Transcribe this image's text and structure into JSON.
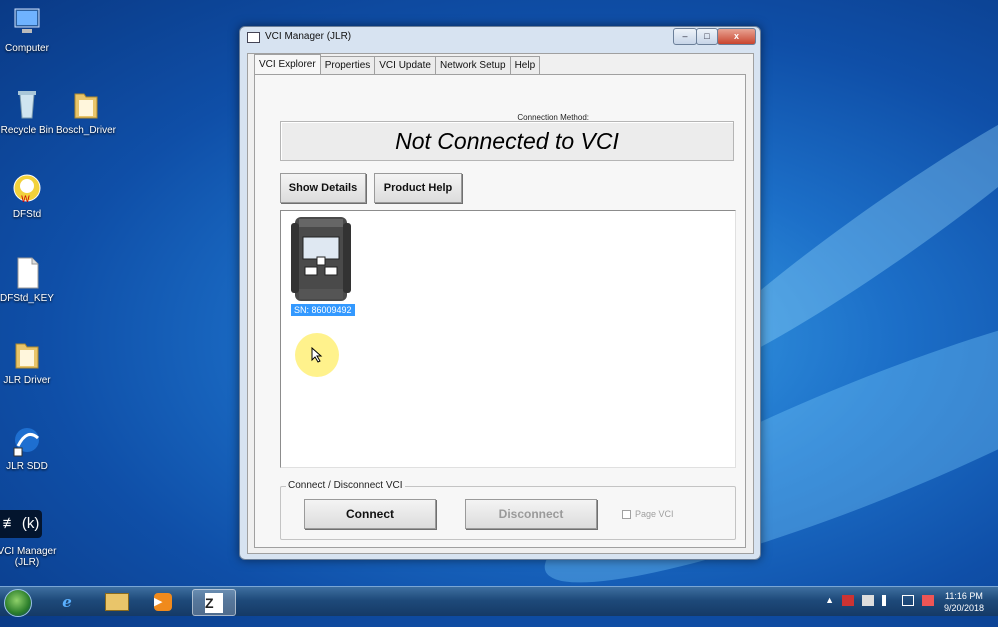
{
  "desktop": {
    "icons": [
      {
        "label": "Computer"
      },
      {
        "label": "Recycle Bin"
      },
      {
        "label": "Bosch_Driver"
      },
      {
        "label": "DFStd"
      },
      {
        "label": "DFStd_KEY"
      },
      {
        "label": "JLR Driver"
      },
      {
        "label": "JLR SDD"
      },
      {
        "label": "VCI Manager (JLR)"
      }
    ],
    "key_overlay": "≢ (k)"
  },
  "window": {
    "title": "VCI Manager (JLR)",
    "controls": {
      "minimize": "–",
      "maximize": "□",
      "close": "x"
    },
    "tabs": [
      {
        "label": "VCI Explorer",
        "active": true
      },
      {
        "label": "Properties"
      },
      {
        "label": "VCI Update"
      },
      {
        "label": "Network Setup"
      },
      {
        "label": "Help"
      }
    ],
    "connection_method_label": "Connection Method:",
    "status": "Not Connected to VCI",
    "buttons": {
      "show_details": "Show Details",
      "product_help": "Product Help"
    },
    "vci_device": {
      "serial": "SN: 86009492"
    },
    "group": {
      "legend": "Connect / Disconnect VCI",
      "connect": "Connect",
      "disconnect": "Disconnect",
      "page_vci": "Page VCI"
    }
  },
  "taskbar": {
    "time": "11:16 PM",
    "date": "9/20/2018",
    "tray_arrow": "▲"
  },
  "colors": {
    "selection": "#3399ff",
    "desktop": "#1c6fc8"
  }
}
